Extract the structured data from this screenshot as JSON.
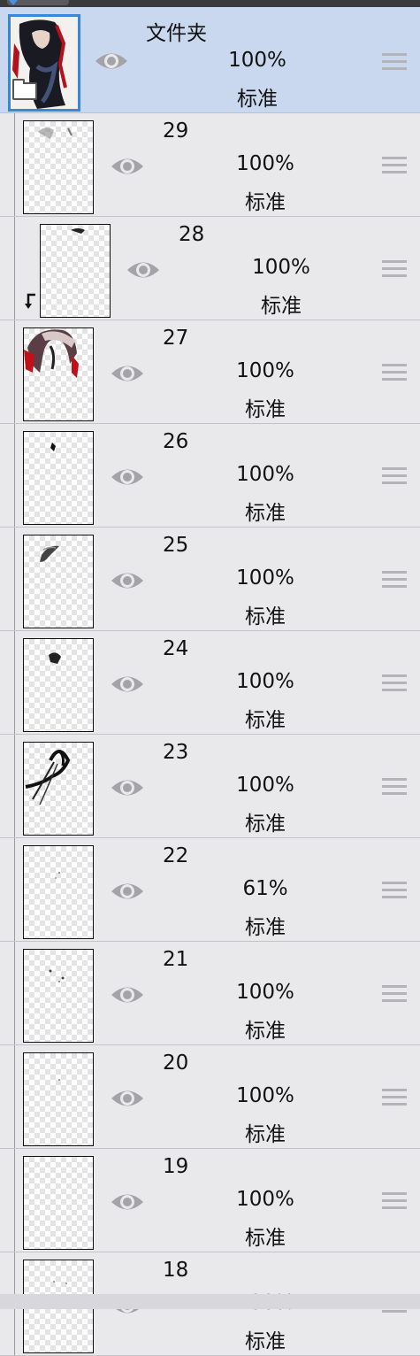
{
  "colors": {
    "selected_row": "#c9d8ef",
    "row": "#e9e9ec",
    "selection_border": "#3a86d8",
    "eye": "#a3a3a8",
    "handle": "#b4b4b8"
  },
  "icons": {
    "visibility": "eye-icon",
    "drag": "drag-handle-icon",
    "folder": "folder-icon",
    "clipping": "clipping-arrow-icon"
  },
  "layers": [
    {
      "name": "文件夹",
      "opacity": "100%",
      "blend": "标准",
      "kind": "folder",
      "selected": true
    },
    {
      "name": "29",
      "opacity": "100%",
      "blend": "标准",
      "kind": "layer"
    },
    {
      "name": "28",
      "opacity": "100%",
      "blend": "标准",
      "kind": "clipped"
    },
    {
      "name": "27",
      "opacity": "100%",
      "blend": "标准",
      "kind": "layer"
    },
    {
      "name": "26",
      "opacity": "100%",
      "blend": "标准",
      "kind": "layer"
    },
    {
      "name": "25",
      "opacity": "100%",
      "blend": "标准",
      "kind": "layer"
    },
    {
      "name": "24",
      "opacity": "100%",
      "blend": "标准",
      "kind": "layer"
    },
    {
      "name": "23",
      "opacity": "100%",
      "blend": "标准",
      "kind": "layer"
    },
    {
      "name": "22",
      "opacity": "61%",
      "blend": "标准",
      "kind": "layer"
    },
    {
      "name": "21",
      "opacity": "100%",
      "blend": "标准",
      "kind": "layer"
    },
    {
      "name": "20",
      "opacity": "100%",
      "blend": "标准",
      "kind": "layer"
    },
    {
      "name": "19",
      "opacity": "100%",
      "blend": "标准",
      "kind": "layer"
    },
    {
      "name": "18",
      "opacity": "100%",
      "blend": "标准",
      "kind": "layer"
    }
  ]
}
